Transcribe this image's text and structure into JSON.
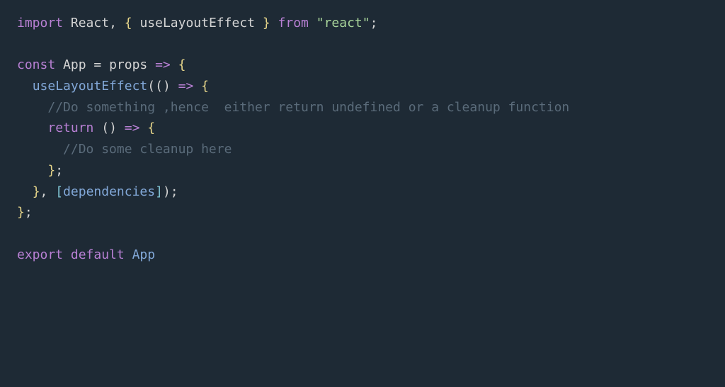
{
  "code": {
    "line1": {
      "import": "import",
      "react": " React",
      "comma": ", ",
      "lbrace": "{ ",
      "hook": "useLayoutEffect",
      "rbrace": " }",
      "from": " from ",
      "quote1": "\"",
      "module": "react",
      "quote2": "\"",
      "semi": ";"
    },
    "line3": {
      "const": "const",
      "app": " App",
      "eq": " = ",
      "props": "props",
      "arrow": " => ",
      "lbrace": "{"
    },
    "line4": {
      "indent": "  ",
      "hook": "useLayoutEffect",
      "lparen": "((",
      "rparen": ") ",
      "arrow": "=> ",
      "lbrace": "{"
    },
    "line5": {
      "indent": "    ",
      "comment": "//Do something ,hence  either return undefined or a cleanup function"
    },
    "line6": {
      "indent": "    ",
      "return": "return",
      "lparen": " (",
      "rparen": ") ",
      "arrow": "=> ",
      "lbrace": "{"
    },
    "line7": {
      "indent": "      ",
      "comment": "//Do some cleanup here"
    },
    "line8": {
      "indent": "    ",
      "rbrace": "}",
      "semi": ";"
    },
    "line9": {
      "indent": "  ",
      "rbrace": "}",
      "comma": ", ",
      "lbracket": "[",
      "deps": "dependencies",
      "rbracket": "]",
      "rparen": ")",
      "semi": ";"
    },
    "line10": {
      "rbrace": "}",
      "semi": ";"
    },
    "line12": {
      "export": "export",
      "default": " default",
      "app": " App"
    }
  }
}
